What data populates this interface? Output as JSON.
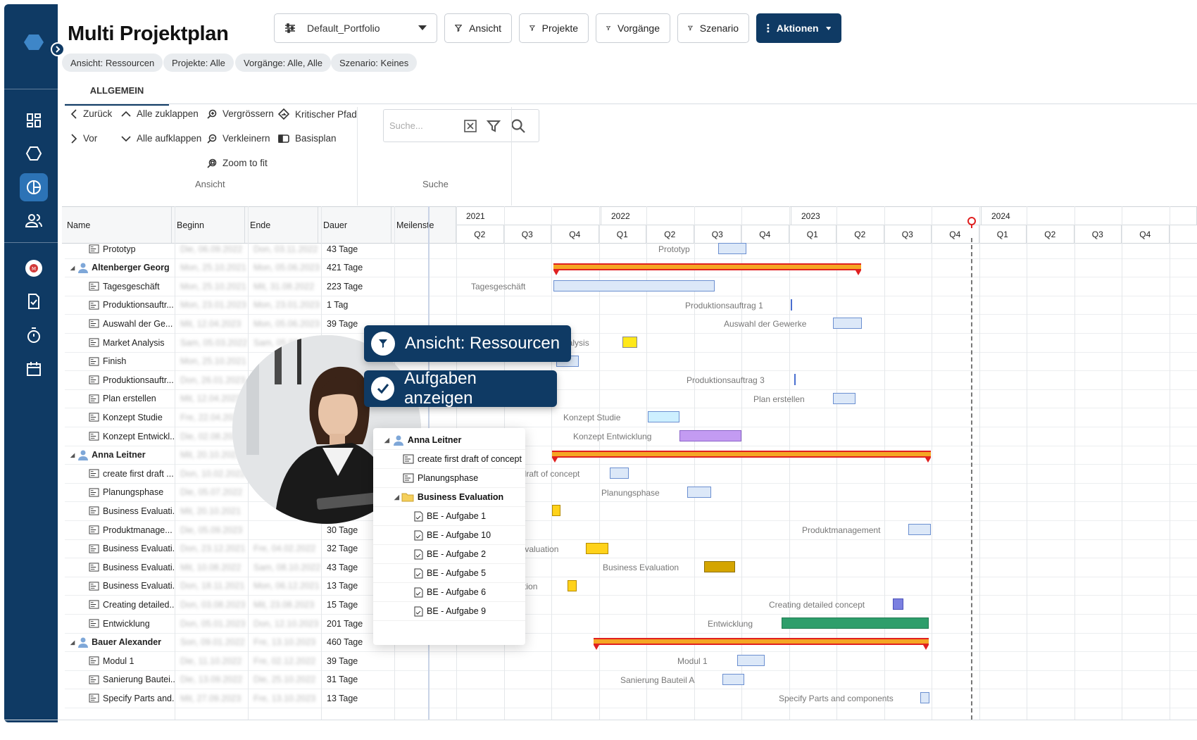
{
  "page": {
    "title": "Multi Projektplan"
  },
  "header": {
    "portfolio_select": "Default_Portfolio",
    "buttons": {
      "ansicht": "Ansicht",
      "projekte": "Projekte",
      "vorgaenge": "Vorgänge",
      "szenario": "Szenario",
      "aktionen": "Aktionen"
    },
    "chips": [
      "Ansicht: Ressourcen",
      "Projekte: Alle",
      "Vorgänge: Alle, Alle",
      "Szenario: Keines"
    ]
  },
  "tabs": {
    "allgemein": "ALLGEMEIN"
  },
  "ribbon": {
    "zurueck": "Zurück",
    "vor": "Vor",
    "alle_zuklappen": "Alle zuklappen",
    "alle_aufklappen": "Alle aufklappen",
    "vergroessern": "Vergrössern",
    "verkleinern": "Verkleinern",
    "zoom_to_fit": "Zoom to fit",
    "kritischer_pfad": "Kritischer Pfad",
    "basisplan": "Basisplan",
    "group_ansicht": "Ansicht",
    "group_suche": "Suche",
    "search_placeholder": "Suche..."
  },
  "grid": {
    "headers": {
      "name": "Name",
      "beginn": "Beginn",
      "ende": "Ende",
      "dauer": "Dauer",
      "meilenstein": "Meilenste"
    }
  },
  "timeline": {
    "years": [
      "2021",
      "2022",
      "2023",
      "2024"
    ],
    "quarters": [
      "Q2",
      "Q3",
      "Q4",
      "Q1",
      "Q2",
      "Q3",
      "Q4",
      "Q1",
      "Q2",
      "Q3",
      "Q4",
      "Q1",
      "Q2",
      "Q3",
      "Q4"
    ]
  },
  "rows": [
    {
      "type": "task",
      "name": "Prototyp",
      "begin": "Die, 06.09.2022",
      "end": "Don, 03.11.2022",
      "duration": "43 Tage"
    },
    {
      "type": "resource",
      "name": "Altenberger Georg",
      "begin": "Mon, 25.10.2021",
      "end": "Mon, 05.06.2023",
      "duration": "421 Tage"
    },
    {
      "type": "task",
      "name": "Tagesgeschäft",
      "begin": "Mon, 25.10.2021",
      "end": "Mit, 31.08.2022",
      "duration": "223 Tage"
    },
    {
      "type": "task",
      "name": "Produktionsauftr...",
      "begin": "Mon, 23.01.2023",
      "end": "Mon, 23.01.2023",
      "duration": "1 Tag"
    },
    {
      "type": "task",
      "name": "Auswahl der Ge...",
      "begin": "Mit, 12.04.2023",
      "end": "Mon, 05.06.2023",
      "duration": "39 Tage"
    },
    {
      "type": "task",
      "name": "Market Analysis",
      "begin": "Sam, 05.03.2022",
      "end": "Sam, 05.03.2022",
      "duration": ""
    },
    {
      "type": "task",
      "name": "Finish",
      "begin": "Mon, 25.10.2021",
      "end": "",
      "duration": ""
    },
    {
      "type": "task",
      "name": "Produktionsauftr...",
      "begin": "Don, 26.01.2023",
      "end": "",
      "duration": ""
    },
    {
      "type": "task",
      "name": "Plan erstellen",
      "begin": "Mit, 12.04.2023",
      "end": "",
      "duration": ""
    },
    {
      "type": "task",
      "name": "Konzept Studie",
      "begin": "Fre, 22.04.2022",
      "end": "",
      "duration": ""
    },
    {
      "type": "task",
      "name": "Konzept Entwickl...",
      "begin": "Die, 02.08.2022",
      "end": "",
      "duration": ""
    },
    {
      "type": "resource",
      "name": "Anna Leitner",
      "begin": "Mit, 20.10.2021",
      "end": "",
      "duration": ""
    },
    {
      "type": "task",
      "name": "create first draft ...",
      "begin": "Don, 10.02.2022",
      "end": "",
      "duration": ""
    },
    {
      "type": "task",
      "name": "Planungsphase",
      "begin": "Die, 05.07.2022",
      "end": "",
      "duration": ""
    },
    {
      "type": "task",
      "name": "Business Evaluati...",
      "begin": "Mit, 20.10.2021",
      "end": "",
      "duration": ""
    },
    {
      "type": "task",
      "name": "Produktmanage...",
      "begin": "Die, 05.09.2023",
      "end": "",
      "duration": "30 Tage"
    },
    {
      "type": "task",
      "name": "Business Evaluati...",
      "begin": "Don, 23.12.2021",
      "end": "Fre, 04.02.2022",
      "duration": "32 Tage"
    },
    {
      "type": "task",
      "name": "Business Evaluati...",
      "begin": "Mit, 10.08.2022",
      "end": "Sam, 08.10.2022",
      "duration": "43 Tage"
    },
    {
      "type": "task",
      "name": "Business Evaluati...",
      "begin": "Don, 18.11.2021",
      "end": "Mon, 06.12.2021",
      "duration": "13 Tage"
    },
    {
      "type": "task",
      "name": "Creating detailed...",
      "begin": "Don, 03.08.2023",
      "end": "Mit, 23.08.2023",
      "duration": "15 Tage"
    },
    {
      "type": "task",
      "name": "Entwicklung",
      "begin": "Don, 05.01.2023",
      "end": "Don, 12.10.2023",
      "duration": "201 Tage"
    },
    {
      "type": "resource",
      "name": "Bauer Alexander",
      "begin": "Son, 09.01.2022",
      "end": "Fre, 13.10.2023",
      "duration": "460 Tage"
    },
    {
      "type": "task",
      "name": "Modul 1",
      "begin": "Die, 11.10.2022",
      "end": "Fre, 02.12.2022",
      "duration": "39 Tage"
    },
    {
      "type": "task",
      "name": "Sanierung Bautei...",
      "begin": "Die, 13.09.2022",
      "end": "Die, 25.10.2022",
      "duration": "31 Tage"
    },
    {
      "type": "task",
      "name": "Specify Parts and...",
      "begin": "Mit, 27.09.2023",
      "end": "Fre, 13.10.2023",
      "duration": "13 Tage"
    }
  ],
  "gantt_labels": {
    "prototyp": "Prototyp",
    "tagesgeschaeft": "Tagesgeschäft",
    "produktionsauftrag1": "Produktionsauftrag 1",
    "auswahl": "Auswahl der Gewerke",
    "market": "t Analysis",
    "produktionsauftrag3": "Produktionsauftrag 3",
    "plan": "Plan erstellen",
    "konzept_studie": "Konzept Studie",
    "konzept_entwicklung": "Konzept Entwicklung",
    "draft": "st draft of concept",
    "planungsphase": "Planungsphase",
    "be1": "on",
    "produktmanagement": "Produktmanagement",
    "be2": "s Evaluation",
    "be3": "Business Evaluation",
    "be4": "luation",
    "creating": "Creating detailed concept",
    "entwicklung": "Entwicklung",
    "modul1": "Modul 1",
    "sanierung": "Sanierung Bauteil A",
    "specify": "Specify Parts and components"
  },
  "popup": {
    "resource": "Anna Leitner",
    "items": [
      "create first draft of concept",
      "Planungsphase"
    ],
    "folder": "Business Evaluation",
    "subitems": [
      "BE - Aufgabe 1",
      "BE - Aufgabe 10",
      "BE - Aufgabe 2",
      "BE - Aufgabe 5",
      "BE - Aufgabe 6",
      "BE - Aufgabe 9"
    ]
  },
  "badges": {
    "ansicht": "Ansicht: Ressourcen",
    "aufgaben": "Aufgaben anzeigen"
  },
  "colors": {
    "navy": "#0f3a64",
    "summary_bar": "#f5a623",
    "summary_edge": "#e02020",
    "task_bar": "#dce8f8",
    "milestone_yellow": "#ffe81a",
    "gold": "#d4a500",
    "green": "#2e9e6b",
    "purple": "#c39bf2",
    "cyan": "#cdefff"
  }
}
